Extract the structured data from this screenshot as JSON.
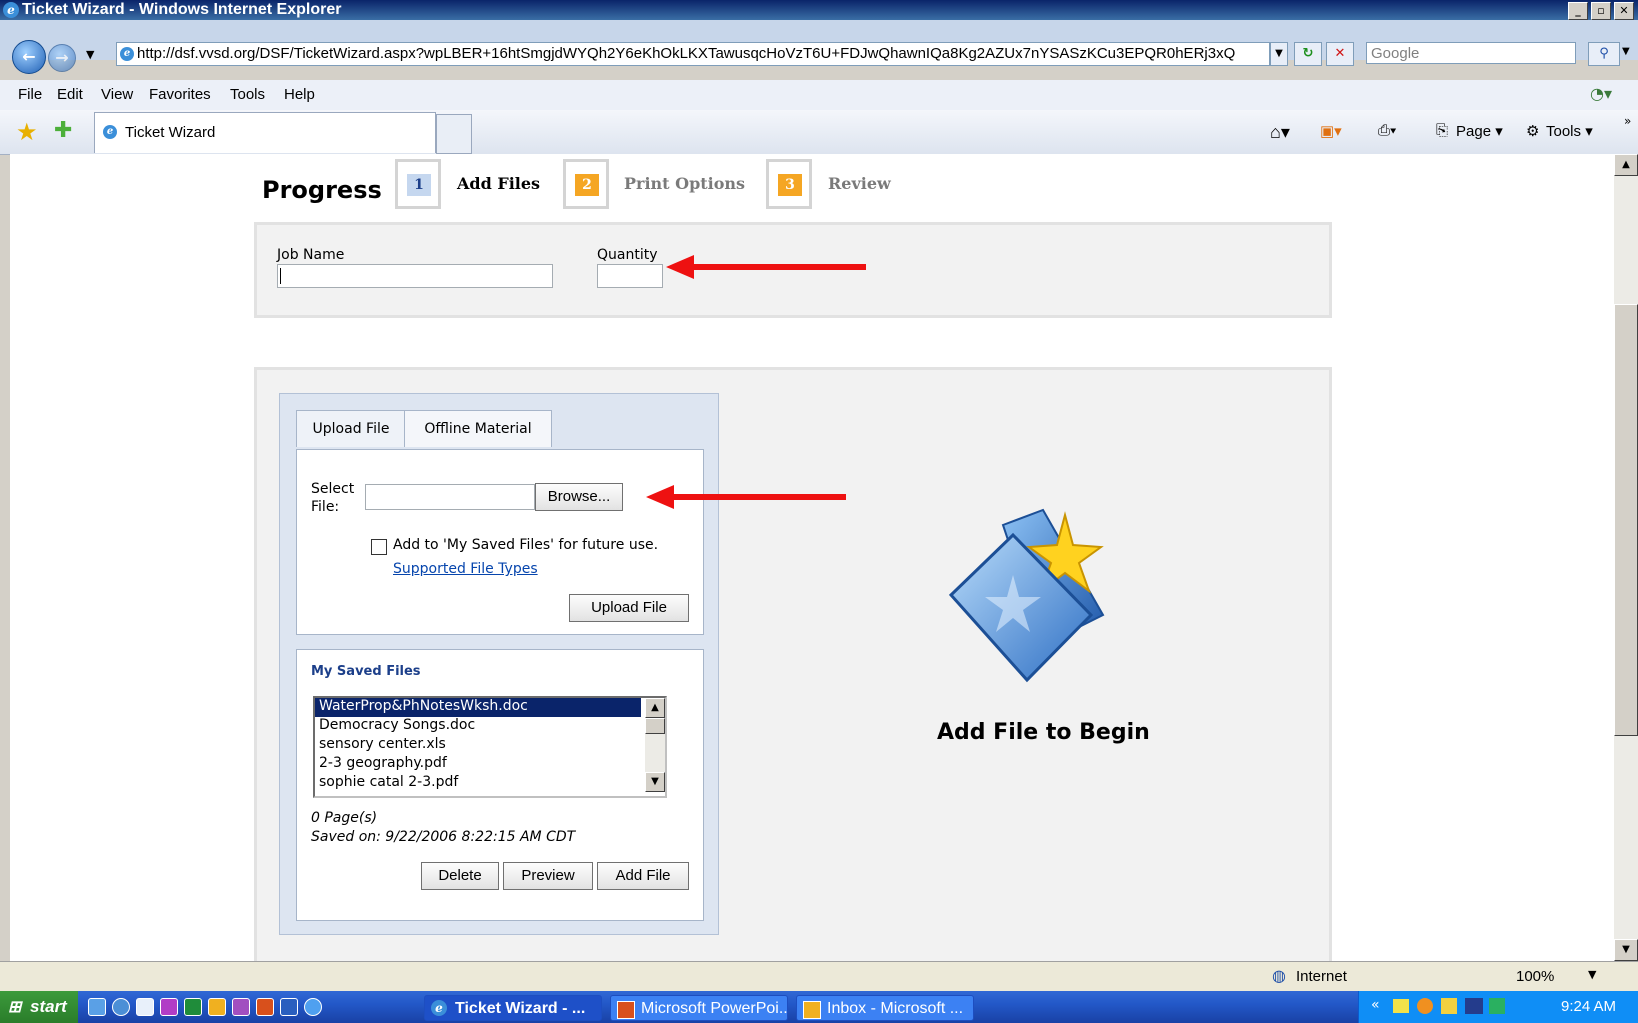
{
  "window": {
    "title": "Ticket Wizard - Windows Internet Explorer"
  },
  "address": {
    "url": "http://dsf.vvsd.org/DSF/TicketWizard.aspx?wpLBER+16htSmgjdWYQh2Y6eKhOkLKXTawusqcHoVzT6U+FDJwQhawnIQa8Kg2AZUx7nYSASzKCu3EPQR0hERj3xQ",
    "search_placeholder": "Google"
  },
  "menu": {
    "items": [
      "File",
      "Edit",
      "View",
      "Favorites",
      "Tools",
      "Help"
    ]
  },
  "tab": {
    "label": "Ticket Wizard"
  },
  "command_bar": {
    "page_label": "Page",
    "tools_label": "Tools"
  },
  "progress": {
    "title": "Progress",
    "steps": [
      {
        "num": "1",
        "label": "Add Files",
        "active": true
      },
      {
        "num": "2",
        "label": "Print Options",
        "active": false
      },
      {
        "num": "3",
        "label": "Review",
        "active": false
      }
    ]
  },
  "job": {
    "job_name_label": "Job Name",
    "job_name_value": "",
    "quantity_label": "Quantity",
    "quantity_value": ""
  },
  "upload": {
    "tabs": [
      "Upload File",
      "Offline Material"
    ],
    "select_file_label_1": "Select",
    "select_file_label_2": "File:",
    "browse_label": "Browse...",
    "save_checkbox_label": "Add to 'My Saved Files' for future use.",
    "supported_link": "Supported File Types",
    "upload_button": "Upload File"
  },
  "saved": {
    "title": "My Saved Files",
    "files": [
      "WaterProp&PhNotesWksh.doc",
      "Democracy Songs.doc",
      "sensory center.xls",
      "2-3 geography.pdf",
      "sophie catal 2-3.pdf"
    ],
    "selected_index": 0,
    "pages": "0 Page(s)",
    "saved_on": "Saved on: 9/22/2006 8:22:15 AM CDT",
    "buttons": {
      "delete": "Delete",
      "preview": "Preview",
      "add": "Add File"
    }
  },
  "main": {
    "add_file_prompt": "Add File to Begin"
  },
  "status": {
    "zone": "Internet",
    "zoom": "100%"
  },
  "taskbar": {
    "start": "start",
    "buttons": [
      "Ticket Wizard - ...",
      "Microsoft PowerPoi...",
      "Inbox - Microsoft ..."
    ],
    "clock": "9:24 AM"
  },
  "colors": {
    "annotation_arrow": "#ee1111",
    "step_active": "#c5d7ef",
    "step_inactive": "#f5a623",
    "link": "#0645ad",
    "selection": "#0a246a"
  }
}
